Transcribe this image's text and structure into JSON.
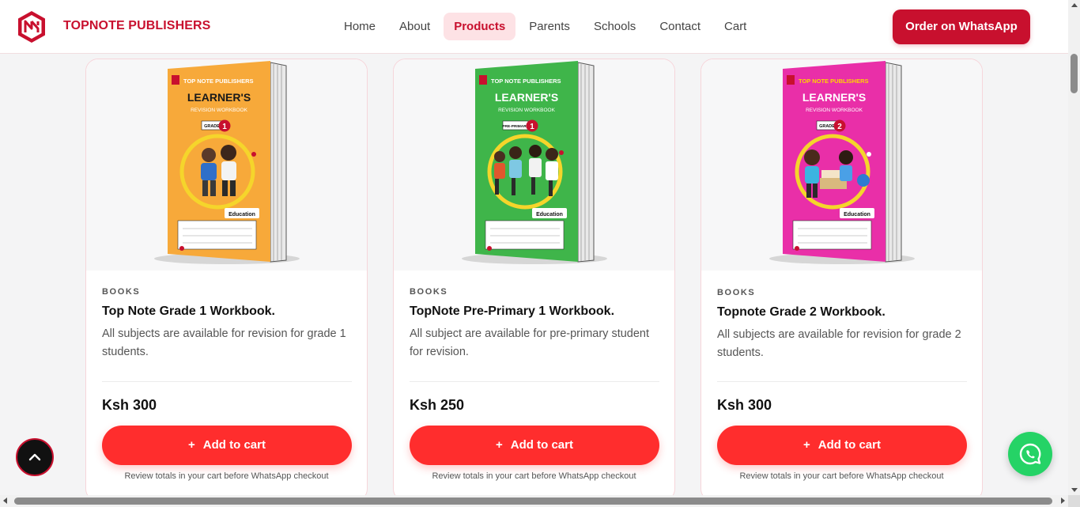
{
  "brand": {
    "name": "TOPNOTE PUBLISHERS",
    "logo_icon": "topnote-logo-icon",
    "color": "#c8102e"
  },
  "nav": {
    "items": [
      {
        "label": "Home"
      },
      {
        "label": "About"
      },
      {
        "label": "Products"
      },
      {
        "label": "Parents"
      },
      {
        "label": "Schools"
      },
      {
        "label": "Contact"
      },
      {
        "label": "Cart"
      }
    ],
    "active": "Products"
  },
  "cta": {
    "order_label": "Order on WhatsApp"
  },
  "products": [
    {
      "category": "BOOKS",
      "title": "Top Note Grade 1 Workbook.",
      "description": "All subjects are available for revision for grade 1 students.",
      "price": "Ksh 300",
      "add_label": "Add to cart",
      "note": "Review totals in your cart before WhatsApp checkout",
      "cover": {
        "color": "#f7a93a",
        "publisher": "TOP NOTE PUBLISHERS",
        "heading": "LEARNER'S",
        "subheading": "REVISION WORKBOOK",
        "level_label": "GRADE",
        "level_number": "1",
        "badge": "Education"
      }
    },
    {
      "category": "BOOKS",
      "title": "TopNote Pre-Primary 1 Workbook.",
      "description": "All subject are available for pre-primary student for revision.",
      "price": "Ksh 250",
      "add_label": "Add to cart",
      "note": "Review totals in your cart before WhatsApp checkout",
      "cover": {
        "color": "#3fb54a",
        "publisher": "TOP NOTE PUBLISHERS",
        "heading": "LEARNER'S",
        "subheading": "REVISION WORKBOOK",
        "level_label": "PRE-PRIMARY",
        "level_number": "1",
        "badge": "Education"
      }
    },
    {
      "category": "BOOKS",
      "title": "Topnote Grade 2 Workbook.",
      "description": "All subjects are available for revision for grade 2 students.",
      "price": "Ksh 300",
      "add_label": "Add to cart",
      "note": "Review totals in your cart before WhatsApp checkout",
      "cover": {
        "color": "#e92fa8",
        "publisher": "TOP NOTE PUBLISHERS",
        "heading": "LEARNER'S",
        "subheading": "REVISION WORKBOOK",
        "level_label": "GRADE",
        "level_number": "2",
        "badge": "Education"
      }
    }
  ],
  "floating": {
    "back_to_top_icon": "chevron-up-icon",
    "whatsapp_icon": "whatsapp-icon"
  }
}
